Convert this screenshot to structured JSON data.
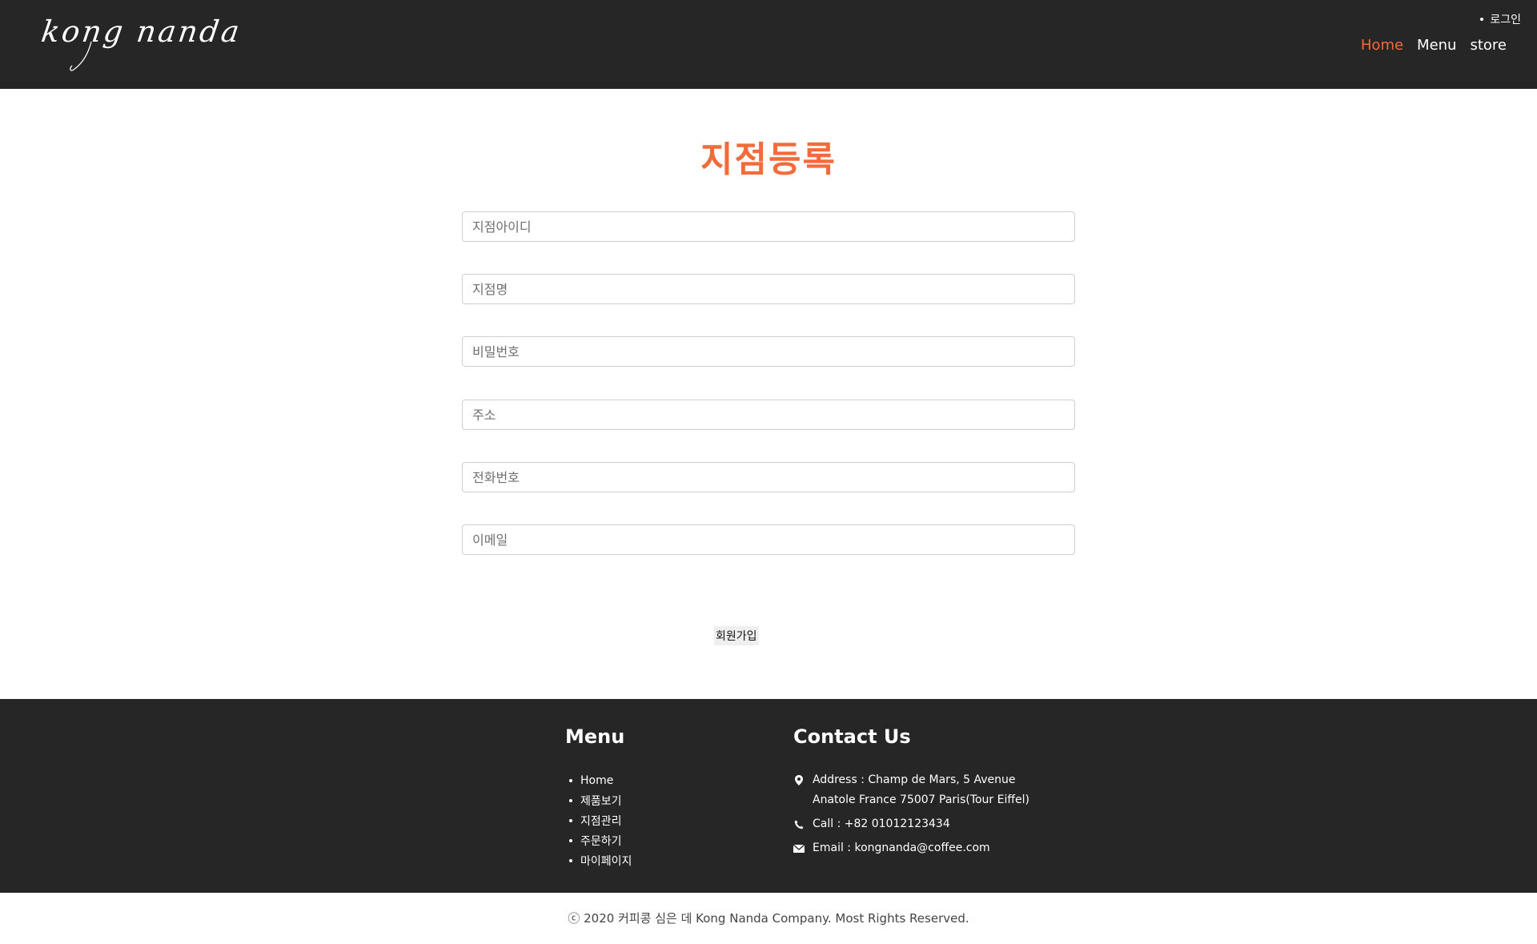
{
  "header": {
    "logo": "kong nanda",
    "login_label": "로그인",
    "nav": [
      {
        "label": "Home",
        "active": true
      },
      {
        "label": "Menu",
        "active": false
      },
      {
        "label": "store",
        "active": false
      }
    ]
  },
  "form": {
    "title": "지점등록",
    "fields": [
      {
        "placeholder": "지점아이디",
        "value": ""
      },
      {
        "placeholder": "지점명",
        "value": ""
      },
      {
        "placeholder": "비밀번호",
        "value": ""
      },
      {
        "placeholder": "주소",
        "value": ""
      },
      {
        "placeholder": "전화번호",
        "value": ""
      },
      {
        "placeholder": "이메일",
        "value": ""
      }
    ],
    "submit_label": "회원가입"
  },
  "footer": {
    "menu_heading": "Menu",
    "menu_items": [
      "Home",
      "제품보기",
      "지점관리",
      "주문하기",
      "마이페이지"
    ],
    "contact_heading": "Contact Us",
    "address": "Address : Champ de Mars, 5 Avenue Anatole France 75007 Paris(Tour Eiffel)",
    "call": "Call : +82 01012123434",
    "email": "Email : kongnanda@coffee.com"
  },
  "copyright": "ⓒ 2020 커피콩 심은 데 Kong Nanda Company. Most Rights Reserved.",
  "colors": {
    "accent": "#f26b3a",
    "dark": "#262626"
  },
  "icons": [
    "map-marker-icon",
    "phone-icon",
    "envelope-icon"
  ]
}
